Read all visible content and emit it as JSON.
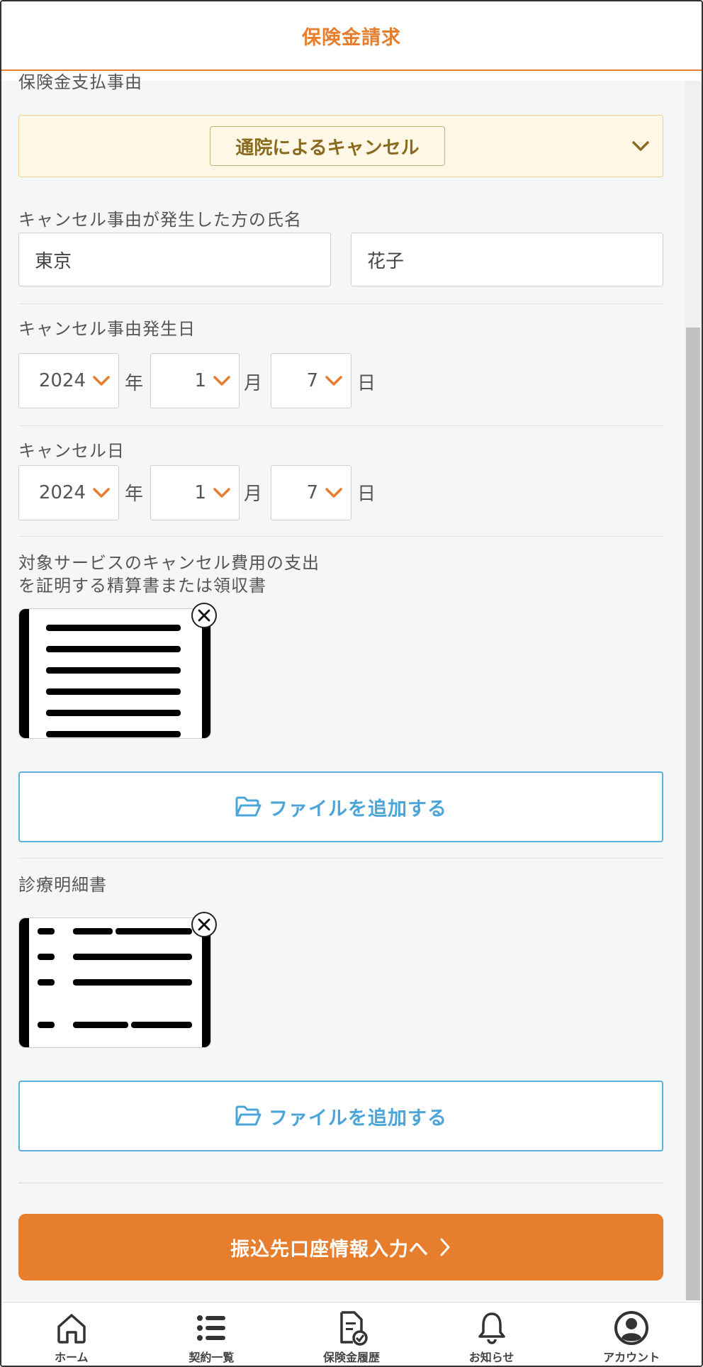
{
  "header": {
    "title": "保険金請求"
  },
  "payment_reason": {
    "label": "保険金支払事由",
    "selected": "通院によるキャンセル"
  },
  "person_name": {
    "label": "キャンセル事由が発生した方の氏名",
    "last_name": "東京",
    "first_name": "花子"
  },
  "occurrence_date": {
    "label": "キャンセル事由発生日",
    "year": "2024",
    "month": "1",
    "day": "7"
  },
  "cancel_date": {
    "label": "キャンセル日",
    "year": "2024",
    "month": "1",
    "day": "7"
  },
  "date_units": {
    "year": "年",
    "month": "月",
    "day": "日"
  },
  "receipt_doc": {
    "label_line1": "対象サービスのキャンセル費用の支出",
    "label_line2": "を証明する精算書または領収書",
    "add_file_label": "ファイルを追加する"
  },
  "medical_doc": {
    "label": "診療明細書",
    "add_file_label": "ファイルを追加する"
  },
  "next_button": {
    "label": "振込先口座情報入力へ"
  },
  "bottom_nav": {
    "items": [
      {
        "label": "ホーム",
        "icon": "home-icon"
      },
      {
        "label": "契約一覧",
        "icon": "list-icon"
      },
      {
        "label": "保険金履歴",
        "icon": "claim-history-icon"
      },
      {
        "label": "お知らせ",
        "icon": "bell-icon"
      },
      {
        "label": "アカウント",
        "icon": "account-icon"
      }
    ]
  },
  "colors": {
    "accent": "#e67e2e",
    "link_blue": "#4ba5d8",
    "select_bg": "#fff8e6",
    "select_text": "#8a6a1e"
  }
}
